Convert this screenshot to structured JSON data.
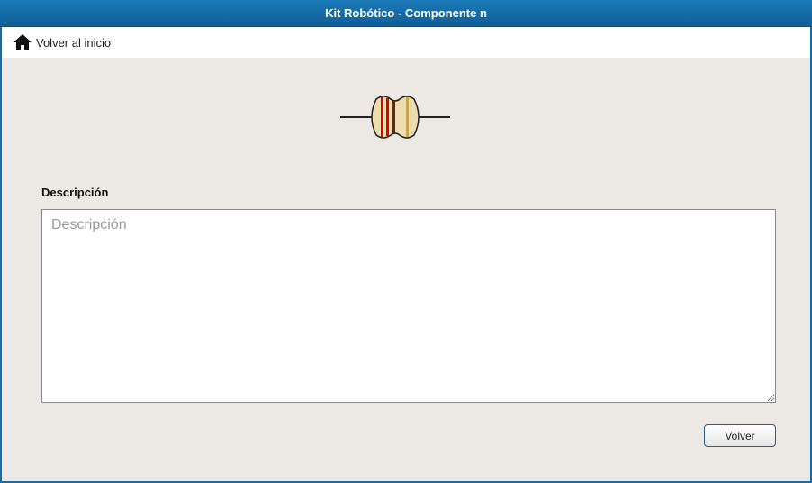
{
  "window": {
    "title": "Kit Robótico - Componente n"
  },
  "nav": {
    "home_label": "Volver al inicio",
    "home_icon": "home-icon"
  },
  "component": {
    "image": "resistor",
    "band_colors": [
      "#e00000",
      "#e00000",
      "#5a2a12",
      "#d4a820"
    ],
    "body_color": "#ecdcae"
  },
  "description": {
    "label": "Descripción",
    "value": "",
    "placeholder": "Descripción"
  },
  "footer": {
    "back_label": "Volver"
  }
}
